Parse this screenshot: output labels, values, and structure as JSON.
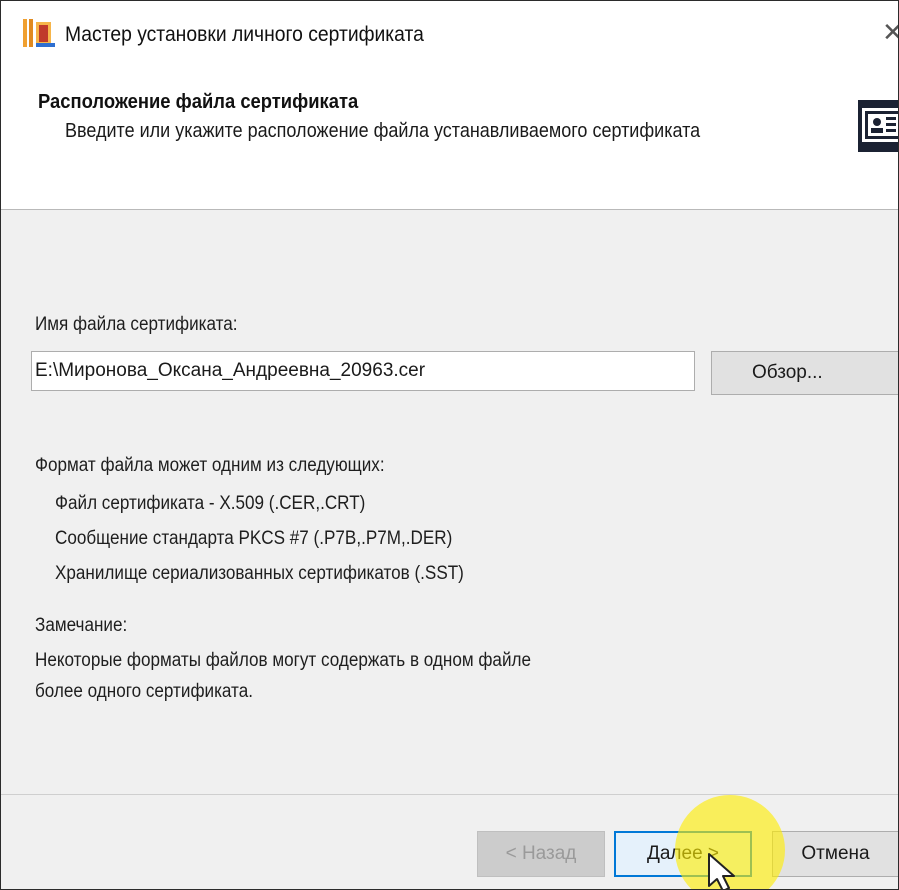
{
  "window": {
    "title": "Мастер установки личного сертификата",
    "close_glyph": "✕"
  },
  "header": {
    "title": "Расположение файла сертификата",
    "subtitle": "Введите или укажите расположение файла устанавливаемого сертификата",
    "icon": "certificate-icon"
  },
  "file": {
    "label": "Имя файла сертификата:",
    "value": "E:\\Миронова_Оксана_Андреевна_20963.cer",
    "browse_label": "Обзор..."
  },
  "formats": {
    "heading": "Формат файла может одним из следующих:",
    "items": [
      "Файл сертификата - X.509 (.CER,.CRT)",
      "Сообщение стандарта PKCS #7 (.P7B,.P7M,.DER)",
      "Хранилище сериализованных сертификатов (.SST)"
    ]
  },
  "note": {
    "heading": "Замечание:",
    "lines": [
      "Некоторые форматы файлов могут содержать в одном файле",
      "более одного сертификата."
    ]
  },
  "buttons": {
    "back": "< Назад",
    "next": "Далее >",
    "cancel": "Отмена"
  },
  "colors": {
    "accent": "#0078d7",
    "highlight": "#ffee00",
    "app_icon_orange": "#f0a030",
    "app_icon_red": "#c0392b"
  }
}
